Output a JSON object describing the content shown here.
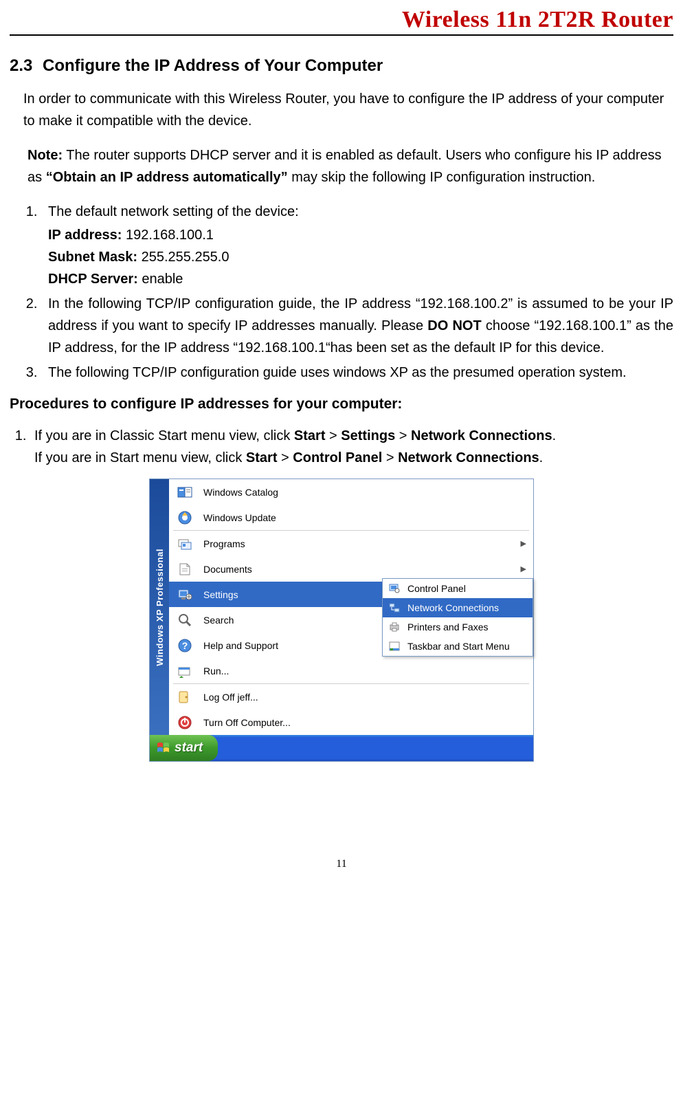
{
  "header": {
    "title": "Wireless 11n 2T2R Router"
  },
  "section": {
    "number": "2.3",
    "title": "Configure the IP Address of Your Computer",
    "intro": "In order to communicate with this Wireless Router, you have to configure the IP address of your computer to make it compatible with the device."
  },
  "note": {
    "label": "Note:",
    "part1": " The router supports DHCP server and it is enabled as default. Users who configure his IP address as ",
    "bold": "“Obtain an IP address automatically”",
    "part2": " may skip the following IP configuration instruction."
  },
  "list1": {
    "item1": {
      "lead": "The default network setting of the device:",
      "ip_label": "IP address:",
      "ip_value": " 192.168.100.1",
      "mask_label": "Subnet Mask:",
      "mask_value": " 255.255.255.0",
      "dhcp_label": "DHCP Server:",
      "dhcp_value": " enable"
    },
    "item2": {
      "part1": "In the following TCP/IP configuration guide, the IP address “192.168.100.2” is assumed to be your IP address if you want to specify IP addresses manually. Please ",
      "bold": "DO NOT",
      "part2": " choose “192.168.100.1” as the IP address, for the IP address “192.168.100.1“has been set as the default IP for this device."
    },
    "item3": "The following TCP/IP configuration guide uses windows XP as the presumed operation system."
  },
  "procHeading": "Procedures to configure IP addresses for your computer:",
  "proc1": {
    "line1a": "If you are in Classic Start menu view, click ",
    "b1": "Start",
    "gt": " > ",
    "b2": "Settings",
    "b3": "Network Connections",
    "dot": ".",
    "line2a": "If you are in Start menu view, click ",
    "b4": "Start",
    "b5": "Control Panel",
    "b6": "Network Connections"
  },
  "screenshot": {
    "sidebar": "Windows XP  Professional",
    "items": {
      "catalog": "Windows Catalog",
      "update": "Windows Update",
      "programs": "Programs",
      "documents": "Documents",
      "settings": "Settings",
      "search": "Search",
      "help": "Help and Support",
      "run": "Run...",
      "logoff": "Log Off jeff...",
      "turnoff": "Turn Off Computer..."
    },
    "submenu": {
      "cp": "Control Panel",
      "nc": "Network Connections",
      "pf": "Printers and Faxes",
      "ts": "Taskbar and Start Menu"
    },
    "start": "start"
  },
  "pageNumber": "11"
}
